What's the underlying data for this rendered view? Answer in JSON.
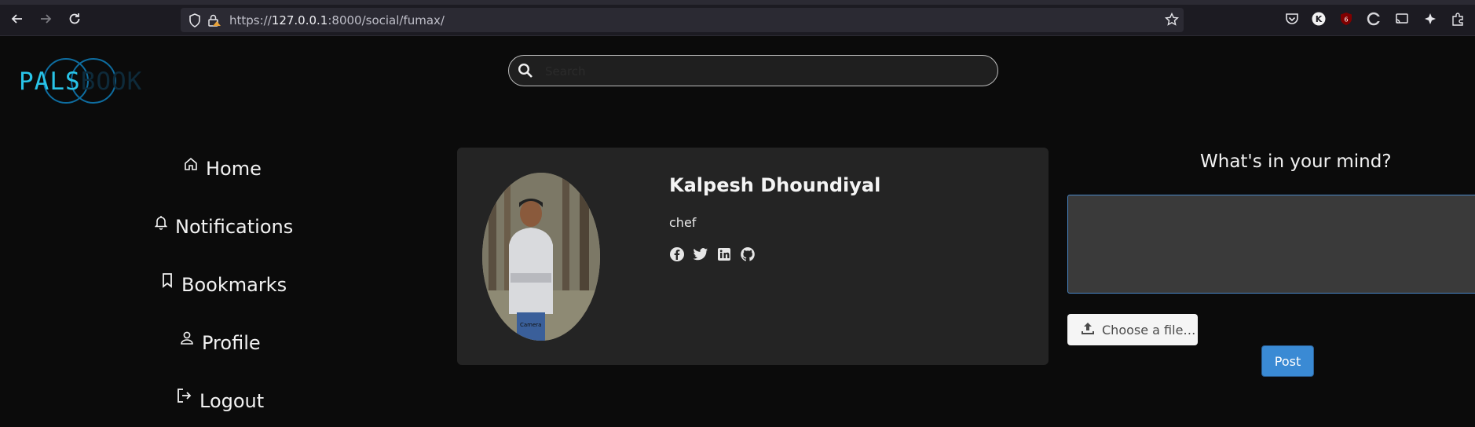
{
  "browser": {
    "url_prefix": "https://",
    "url_host": "127.0.0.1",
    "url_path": ":8000/social/fumax/",
    "extension_badges": [
      "K",
      "6"
    ]
  },
  "logo": {
    "part1": "PALS",
    "part2": "BOOK",
    "color_primary": "#29c4e8",
    "color_secondary": "#0e2a3a"
  },
  "search": {
    "placeholder": "Search",
    "value": ""
  },
  "sidebar": {
    "items": [
      {
        "label": "Home",
        "icon": "home-icon"
      },
      {
        "label": "Notifications",
        "icon": "bell-icon"
      },
      {
        "label": "Bookmarks",
        "icon": "bookmark-icon"
      },
      {
        "label": "Profile",
        "icon": "person-icon"
      },
      {
        "label": "Logout",
        "icon": "logout-icon"
      }
    ]
  },
  "profile": {
    "name": "Kalpesh Dhoundiyal",
    "occupation": "chef",
    "avatar_caption": "Camera",
    "socials": [
      "facebook-icon",
      "twitter-icon",
      "linkedin-icon",
      "github-icon"
    ]
  },
  "composer": {
    "title": "What's in your mind?",
    "text_value": "",
    "file_label": "Choose a file…",
    "post_label": "Post",
    "accent": "#3a8ad4"
  }
}
